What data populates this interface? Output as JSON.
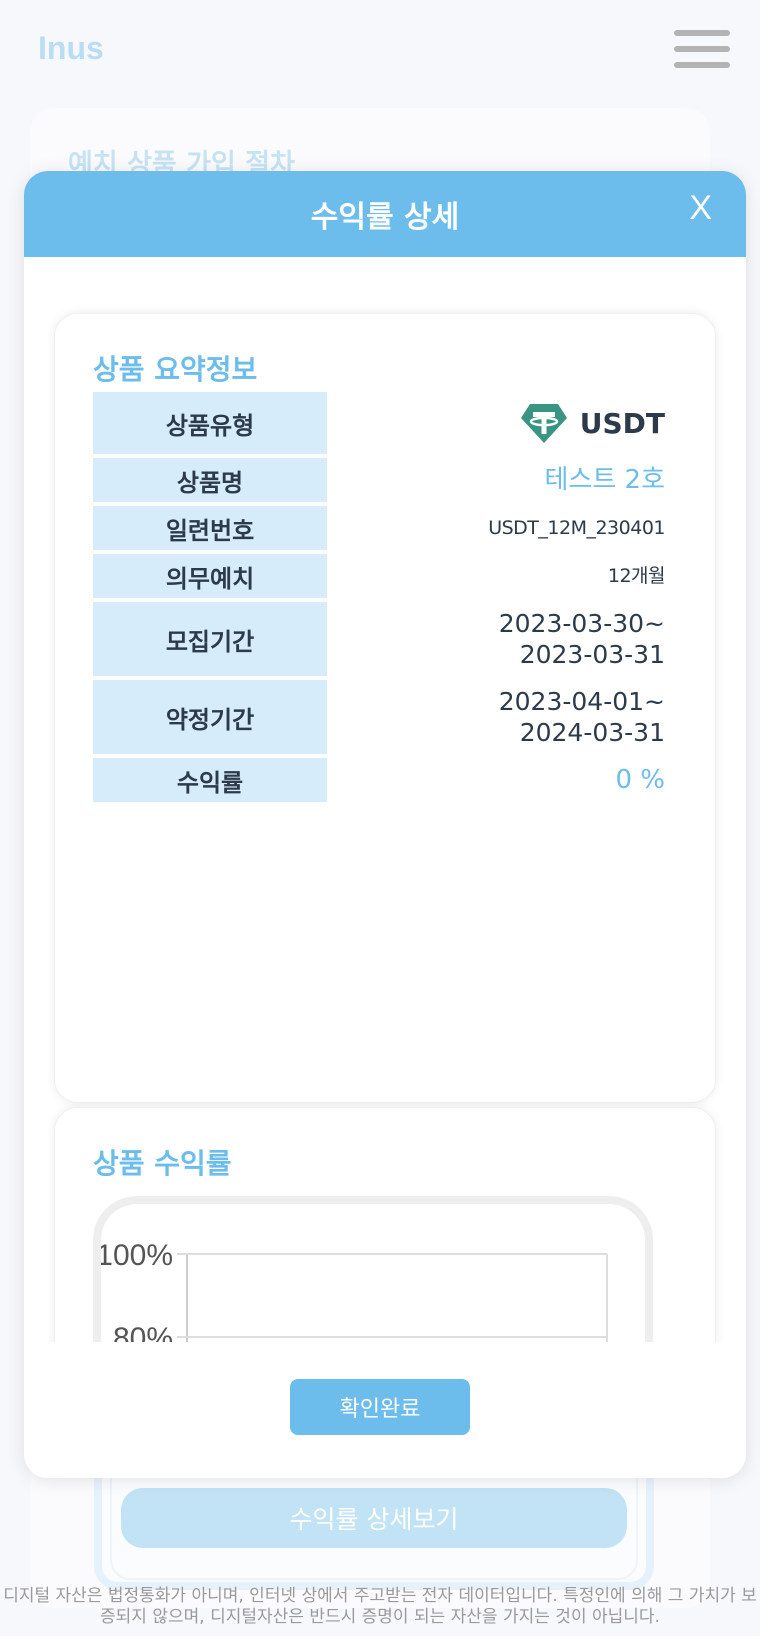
{
  "background": {
    "brand": "Inus",
    "card_title": "예치 상품 가입 절차",
    "detail_button": "수익률 상세보기",
    "disclaimer_line1": "디지털 자산은 법정통화가 아니며, 인터넷 상에서 주고받는 전자 데이터입니다. 특정인에 의해 그 가치가 보",
    "disclaimer_line2": "증되지 않으며, 디지털자산은 반드시 증명이 되는 자산을 가지는 것이 아닙니다."
  },
  "modal": {
    "title": "수익률 상세",
    "close_label": "X",
    "summary": {
      "title": "상품 요약정보",
      "rows": {
        "type_label": "상품유형",
        "type_value": "USDT",
        "name_label": "상품명",
        "name_value": "테스트 2호",
        "serial_label": "일련번호",
        "serial_value": "USDT_12M_230401",
        "lock_label": "의무예치",
        "lock_value": "12개월",
        "recruit_label": "모집기간",
        "recruit_start": "2023-03-30~",
        "recruit_end": "2023-03-31",
        "term_label": "약정기간",
        "term_start": "2023-04-01~",
        "term_end": "2024-03-31",
        "yield_label": "수익률",
        "yield_value": "0 %"
      }
    },
    "yield_section": {
      "title": "상품 수익률"
    },
    "confirm_button": "확인완료"
  },
  "colors": {
    "accent": "#6cbcec",
    "label_bg": "#d6ecfa",
    "usdt_green": "#3a9483"
  },
  "chart_data": {
    "type": "line",
    "y_tick_labels": [
      "100%",
      "80%"
    ],
    "ylim": [
      0,
      100
    ],
    "series": [],
    "grid": true
  }
}
